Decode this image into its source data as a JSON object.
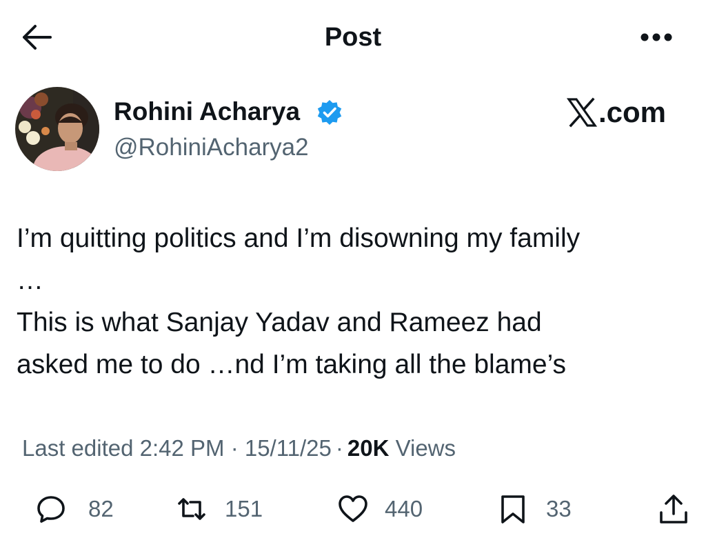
{
  "header": {
    "title": "Post",
    "back_icon": "arrow-left-icon",
    "more_icon": "more-horizontal-icon"
  },
  "author": {
    "name": "Rohini Acharya",
    "handle": "@RohiniAcharya2",
    "verified": true,
    "verified_color": "#1d9bf0"
  },
  "brand": {
    "logo_icon": "x-logo-icon",
    "text": ".com"
  },
  "tweet": {
    "text": "I’m quitting politics and I’m disowning my family\n…\nThis is what Sanjay Yadav and Rameez had\nasked me to do …nd I’m taking all the blame’s"
  },
  "meta": {
    "edited_label": "Last edited 2:42 PM · 15/11/25",
    "views_count": "20K",
    "views_label": "Views"
  },
  "actions": {
    "replies": "82",
    "reposts": "151",
    "likes": "440",
    "bookmarks": "33"
  },
  "colors": {
    "text": "#0f1419",
    "secondary": "#536471",
    "accent": "#1d9bf0"
  }
}
